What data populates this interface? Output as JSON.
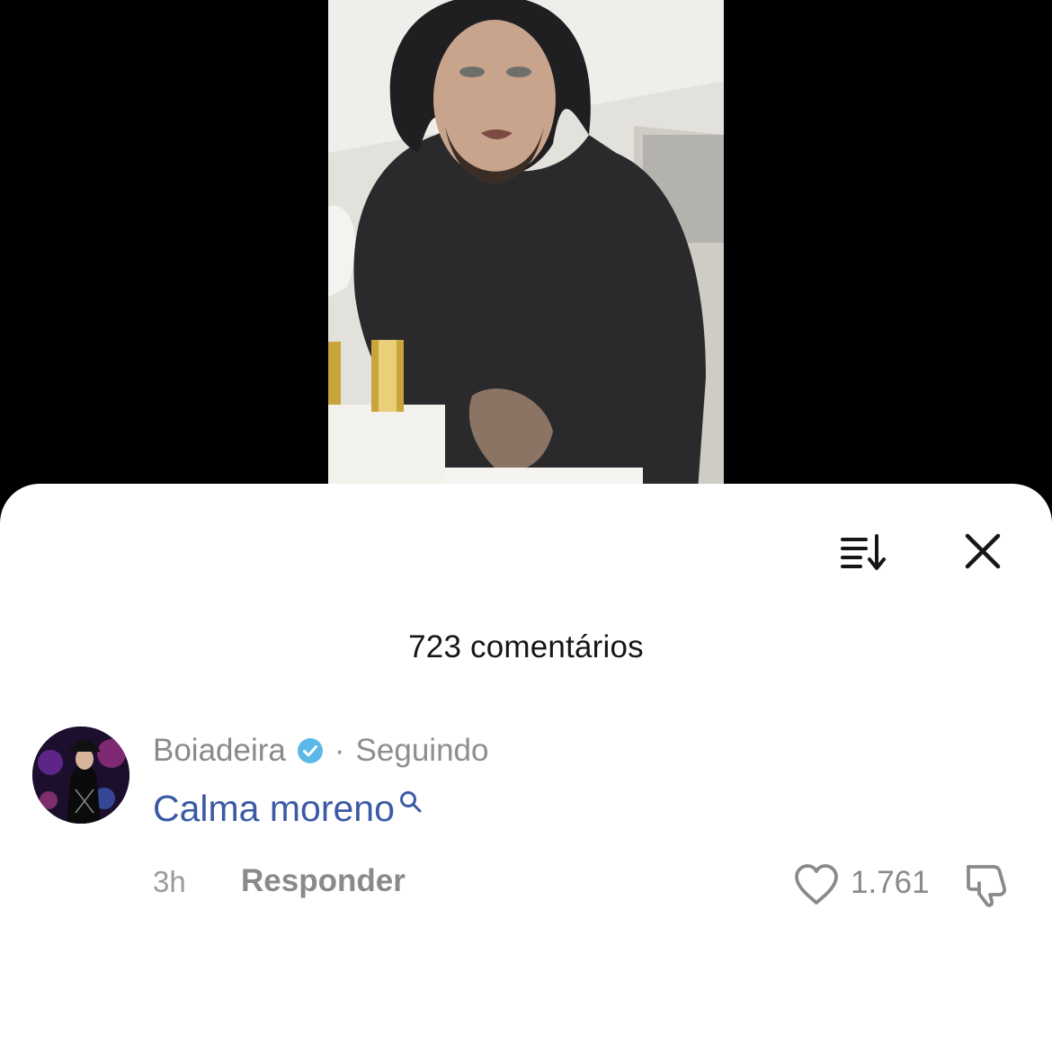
{
  "video": {
    "description_icon": "video-frame"
  },
  "comments_sheet": {
    "sort_icon": "sort-icon",
    "close_icon": "close-icon",
    "count_label": "723 comentários"
  },
  "comment": {
    "username": "Boiadeira",
    "verified_icon": "verified-badge-icon",
    "separator": "·",
    "follow_status": "Seguindo",
    "text": "Calma moreno",
    "text_search_icon": "search-icon",
    "time": "3h",
    "reply_label": "Responder",
    "like_icon": "heart-icon",
    "like_count": "1.761",
    "dislike_icon": "thumbs-down-icon"
  },
  "colors": {
    "sheet_bg": "#ffffff",
    "link_blue": "#3b5aa4",
    "verified_blue": "#5cb8e6",
    "muted_gray": "#8a8a8a"
  }
}
